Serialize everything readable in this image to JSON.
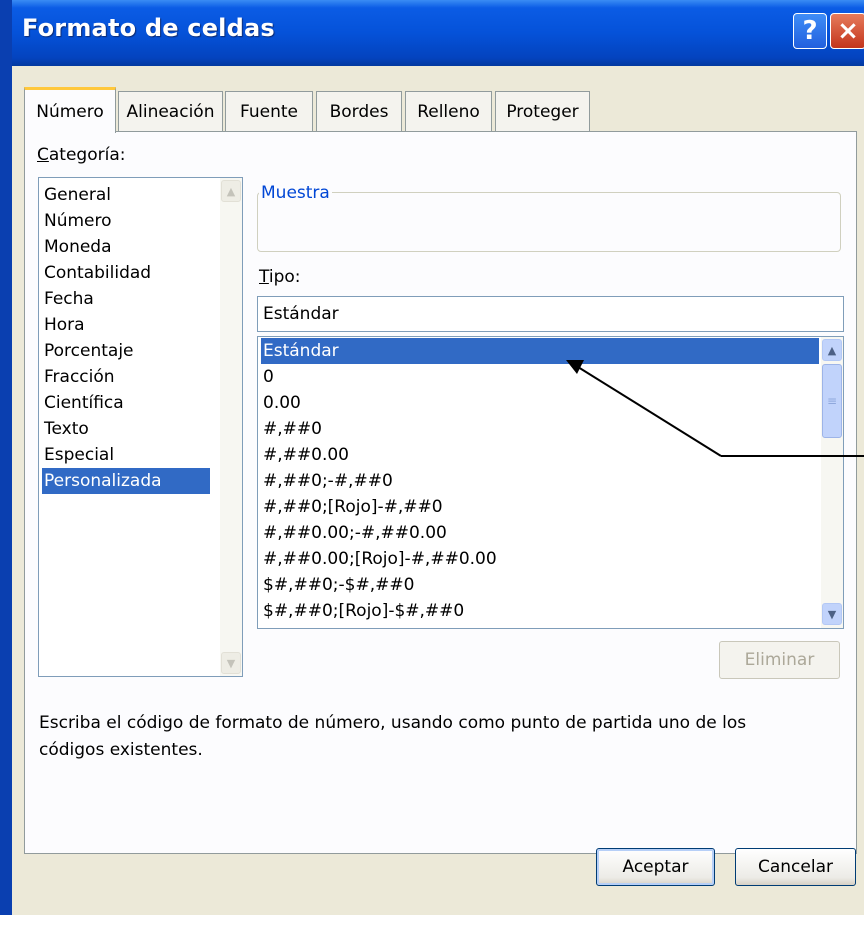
{
  "window": {
    "title": "Formato de celdas",
    "help_label": "?",
    "close_label": "×"
  },
  "tabs": [
    "Número",
    "Alineación",
    "Fuente",
    "Bordes",
    "Relleno",
    "Proteger"
  ],
  "categoria": {
    "label_prefix": "C",
    "label_rest": "ategoría:",
    "items": [
      "General",
      "Número",
      "Moneda",
      "Contabilidad",
      "Fecha",
      "Hora",
      "Porcentaje",
      "Fracción",
      "Científica",
      "Texto",
      "Especial",
      "Personalizada"
    ],
    "selected": "Personalizada"
  },
  "muestra": {
    "title": "Muestra"
  },
  "tipo": {
    "label_prefix": "T",
    "label_rest": "ipo:",
    "value": "Estándar",
    "items": [
      "Estándar",
      "0",
      "0.00",
      "#,##0",
      "#,##0.00",
      "#,##0;-#,##0",
      "#,##0;[Rojo]-#,##0",
      "#,##0.00;-#,##0.00",
      "#,##0.00;[Rojo]-#,##0.00",
      "$#,##0;-$#,##0",
      "$#,##0;[Rojo]-$#,##0"
    ],
    "selected": "Estándar"
  },
  "buttons": {
    "eliminar": "Eliminar",
    "aceptar": "Aceptar",
    "cancelar": "Cancelar"
  },
  "description": "Escriba el código de formato de número, usando como punto de partida uno de los códigos existentes.",
  "icons": {
    "scroll_up": "chevron-up-icon",
    "scroll_down": "chevron-down-icon",
    "pointer": "annotation-arrow"
  },
  "colors": {
    "titlebar": "#0552d9",
    "selection": "#316ac5",
    "tab_highlight": "#ffc83c",
    "group_title": "#0046d5"
  }
}
